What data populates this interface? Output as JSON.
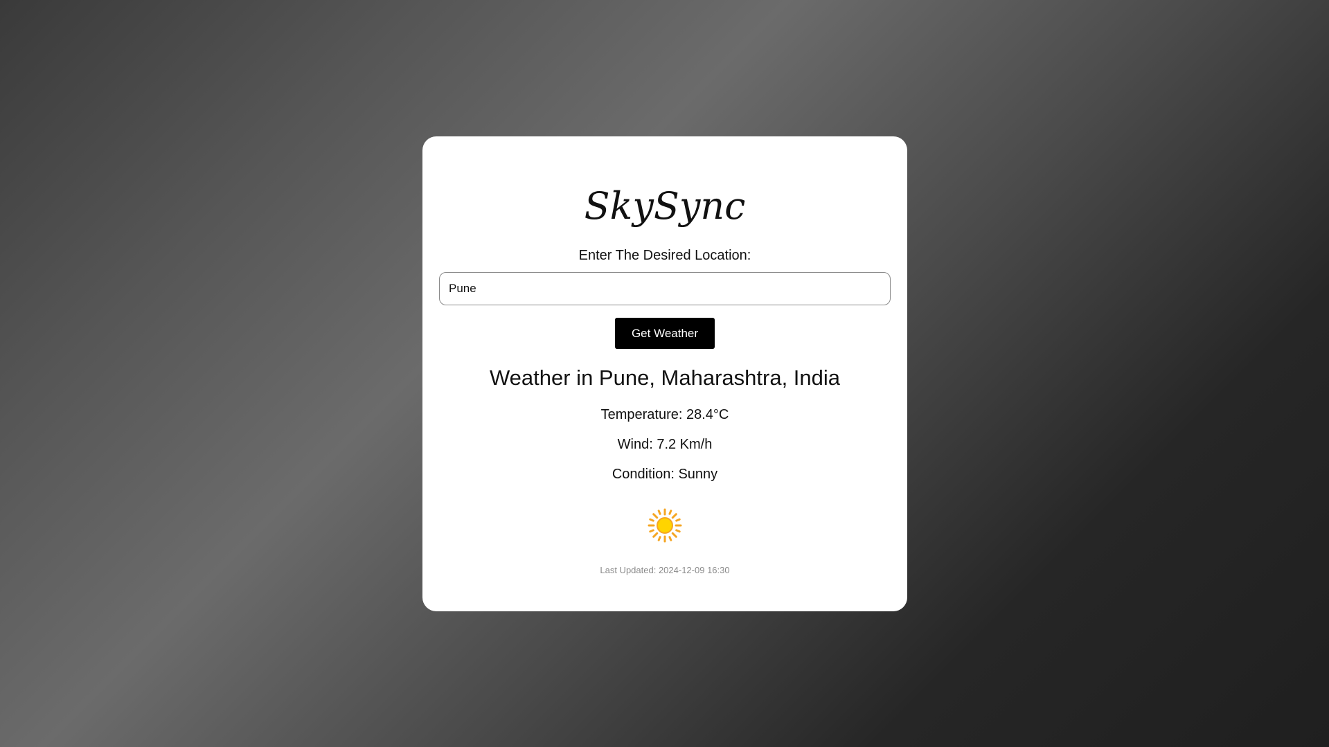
{
  "app": {
    "title": "SkySync"
  },
  "search": {
    "prompt": "Enter The Desired Location:",
    "value": "Pune",
    "button_label": "Get Weather"
  },
  "weather": {
    "heading": "Weather in Pune, Maharashtra, India",
    "temperature": "Temperature: 28.4°C",
    "wind": "Wind: 7.2 Km/h",
    "condition": "Condition: Sunny",
    "condition_icon": "sun-icon",
    "last_updated_label": "Last Updated:",
    "last_updated_value": "2024-12-09 16:30"
  },
  "colors": {
    "card_bg": "#ffffff",
    "button_bg": "#000000",
    "button_text": "#ffffff",
    "sun_core": "#FFD400",
    "sun_rays": "#F5A623",
    "muted_text": "#8a8a8a"
  }
}
